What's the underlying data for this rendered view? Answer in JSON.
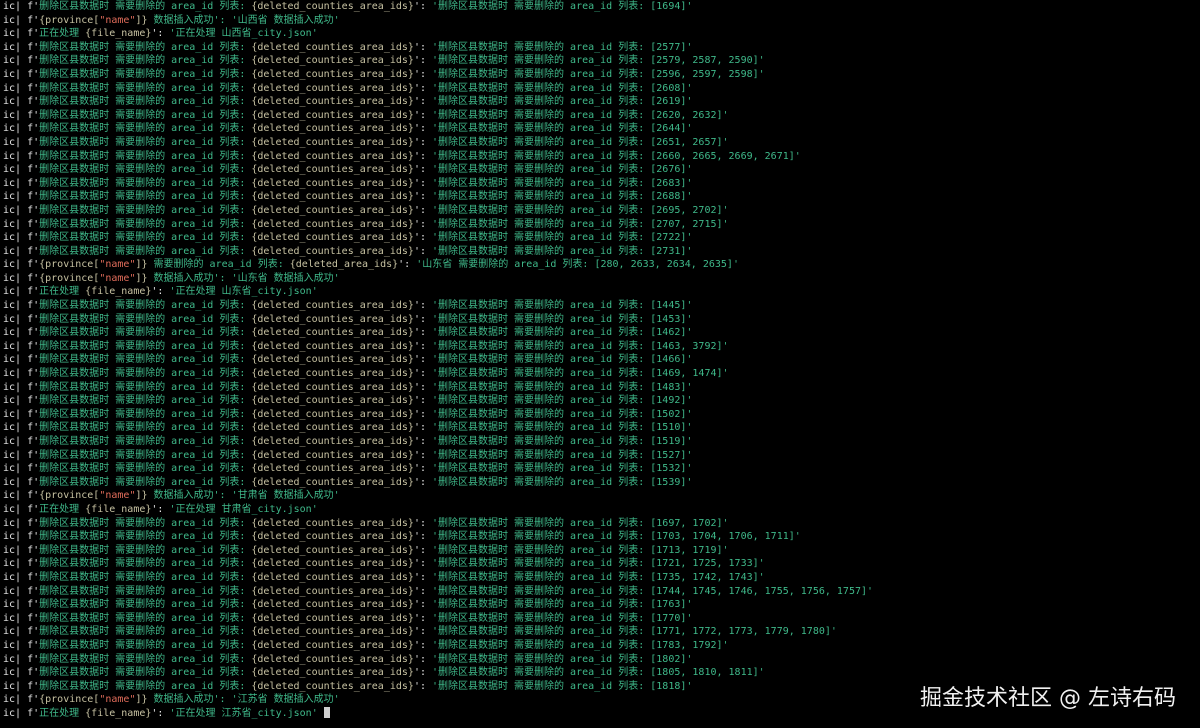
{
  "colors": {
    "background": "#000000",
    "text": "#e6e6e6",
    "string": "#3fb98a",
    "interp": "#c7c2a2",
    "key": "#e06c5a",
    "watermark": "#f0f0f0"
  },
  "lines": [
    [
      [
        "ic| f'",
        "t"
      ],
      [
        "删除区县数据时 需要删除的 area_id 列表: ",
        "s"
      ],
      [
        "{deleted_counties_area_ids}",
        "i"
      ],
      [
        "': ",
        "t"
      ],
      [
        "'删除区县数据时 需要删除的 area_id 列表: [1694]'",
        "s"
      ]
    ],
    [
      [
        "ic| f'",
        "t"
      ],
      [
        "{province[",
        "i"
      ],
      [
        "\"name\"",
        "k"
      ],
      [
        "]}",
        "i"
      ],
      [
        " 数据插入成功': ",
        "s"
      ],
      [
        "'山西省 数据插入成功'",
        "s"
      ]
    ],
    [
      [
        "ic| f'",
        "t"
      ],
      [
        "正在处理 ",
        "s"
      ],
      [
        "{file_name}",
        "i"
      ],
      [
        "': ",
        "t"
      ],
      [
        "'正在处理 山西省_city.json'",
        "s"
      ]
    ],
    [
      [
        "ic| f'",
        "t"
      ],
      [
        "删除区县数据时 需要删除的 area_id 列表: ",
        "s"
      ],
      [
        "{deleted_counties_area_ids}",
        "i"
      ],
      [
        "': ",
        "t"
      ],
      [
        "'删除区县数据时 需要删除的 area_id 列表: [2577]'",
        "s"
      ]
    ],
    [
      [
        "ic| f'",
        "t"
      ],
      [
        "删除区县数据时 需要删除的 area_id 列表: ",
        "s"
      ],
      [
        "{deleted_counties_area_ids}",
        "i"
      ],
      [
        "': ",
        "t"
      ],
      [
        "'删除区县数据时 需要删除的 area_id 列表: [2579, 2587, 2590]'",
        "s"
      ]
    ],
    [
      [
        "ic| f'",
        "t"
      ],
      [
        "删除区县数据时 需要删除的 area_id 列表: ",
        "s"
      ],
      [
        "{deleted_counties_area_ids}",
        "i"
      ],
      [
        "': ",
        "t"
      ],
      [
        "'删除区县数据时 需要删除的 area_id 列表: [2596, 2597, 2598]'",
        "s"
      ]
    ],
    [
      [
        "ic| f'",
        "t"
      ],
      [
        "删除区县数据时 需要删除的 area_id 列表: ",
        "s"
      ],
      [
        "{deleted_counties_area_ids}",
        "i"
      ],
      [
        "': ",
        "t"
      ],
      [
        "'删除区县数据时 需要删除的 area_id 列表: [2608]'",
        "s"
      ]
    ],
    [
      [
        "ic| f'",
        "t"
      ],
      [
        "删除区县数据时 需要删除的 area_id 列表: ",
        "s"
      ],
      [
        "{deleted_counties_area_ids}",
        "i"
      ],
      [
        "': ",
        "t"
      ],
      [
        "'删除区县数据时 需要删除的 area_id 列表: [2619]'",
        "s"
      ]
    ],
    [
      [
        "ic| f'",
        "t"
      ],
      [
        "删除区县数据时 需要删除的 area_id 列表: ",
        "s"
      ],
      [
        "{deleted_counties_area_ids}",
        "i"
      ],
      [
        "': ",
        "t"
      ],
      [
        "'删除区县数据时 需要删除的 area_id 列表: [2620, 2632]'",
        "s"
      ]
    ],
    [
      [
        "ic| f'",
        "t"
      ],
      [
        "删除区县数据时 需要删除的 area_id 列表: ",
        "s"
      ],
      [
        "{deleted_counties_area_ids}",
        "i"
      ],
      [
        "': ",
        "t"
      ],
      [
        "'删除区县数据时 需要删除的 area_id 列表: [2644]'",
        "s"
      ]
    ],
    [
      [
        "ic| f'",
        "t"
      ],
      [
        "删除区县数据时 需要删除的 area_id 列表: ",
        "s"
      ],
      [
        "{deleted_counties_area_ids}",
        "i"
      ],
      [
        "': ",
        "t"
      ],
      [
        "'删除区县数据时 需要删除的 area_id 列表: [2651, 2657]'",
        "s"
      ]
    ],
    [
      [
        "ic| f'",
        "t"
      ],
      [
        "删除区县数据时 需要删除的 area_id 列表: ",
        "s"
      ],
      [
        "{deleted_counties_area_ids}",
        "i"
      ],
      [
        "': ",
        "t"
      ],
      [
        "'删除区县数据时 需要删除的 area_id 列表: [2660, 2665, 2669, 2671]'",
        "s"
      ]
    ],
    [
      [
        "ic| f'",
        "t"
      ],
      [
        "删除区县数据时 需要删除的 area_id 列表: ",
        "s"
      ],
      [
        "{deleted_counties_area_ids}",
        "i"
      ],
      [
        "': ",
        "t"
      ],
      [
        "'删除区县数据时 需要删除的 area_id 列表: [2676]'",
        "s"
      ]
    ],
    [
      [
        "ic| f'",
        "t"
      ],
      [
        "删除区县数据时 需要删除的 area_id 列表: ",
        "s"
      ],
      [
        "{deleted_counties_area_ids}",
        "i"
      ],
      [
        "': ",
        "t"
      ],
      [
        "'删除区县数据时 需要删除的 area_id 列表: [2683]'",
        "s"
      ]
    ],
    [
      [
        "ic| f'",
        "t"
      ],
      [
        "删除区县数据时 需要删除的 area_id 列表: ",
        "s"
      ],
      [
        "{deleted_counties_area_ids}",
        "i"
      ],
      [
        "': ",
        "t"
      ],
      [
        "'删除区县数据时 需要删除的 area_id 列表: [2688]'",
        "s"
      ]
    ],
    [
      [
        "ic| f'",
        "t"
      ],
      [
        "删除区县数据时 需要删除的 area_id 列表: ",
        "s"
      ],
      [
        "{deleted_counties_area_ids}",
        "i"
      ],
      [
        "': ",
        "t"
      ],
      [
        "'删除区县数据时 需要删除的 area_id 列表: [2695, 2702]'",
        "s"
      ]
    ],
    [
      [
        "ic| f'",
        "t"
      ],
      [
        "删除区县数据时 需要删除的 area_id 列表: ",
        "s"
      ],
      [
        "{deleted_counties_area_ids}",
        "i"
      ],
      [
        "': ",
        "t"
      ],
      [
        "'删除区县数据时 需要删除的 area_id 列表: [2707, 2715]'",
        "s"
      ]
    ],
    [
      [
        "ic| f'",
        "t"
      ],
      [
        "删除区县数据时 需要删除的 area_id 列表: ",
        "s"
      ],
      [
        "{deleted_counties_area_ids}",
        "i"
      ],
      [
        "': ",
        "t"
      ],
      [
        "'删除区县数据时 需要删除的 area_id 列表: [2722]'",
        "s"
      ]
    ],
    [
      [
        "ic| f'",
        "t"
      ],
      [
        "删除区县数据时 需要删除的 area_id 列表: ",
        "s"
      ],
      [
        "{deleted_counties_area_ids}",
        "i"
      ],
      [
        "': ",
        "t"
      ],
      [
        "'删除区县数据时 需要删除的 area_id 列表: [2731]'",
        "s"
      ]
    ],
    [
      [
        "ic| f'",
        "t"
      ],
      [
        "{province[",
        "i"
      ],
      [
        "\"name\"",
        "k"
      ],
      [
        "]}",
        "i"
      ],
      [
        " 需要删除的 area_id 列表: ",
        "s"
      ],
      [
        "{deleted_area_ids}",
        "i"
      ],
      [
        "': ",
        "t"
      ],
      [
        "'山东省 需要删除的 area_id 列表: [280, 2633, 2634, 2635]'",
        "s"
      ]
    ],
    [
      [
        "ic| f'",
        "t"
      ],
      [
        "{province[",
        "i"
      ],
      [
        "\"name\"",
        "k"
      ],
      [
        "]}",
        "i"
      ],
      [
        " 数据插入成功': ",
        "s"
      ],
      [
        "'山东省 数据插入成功'",
        "s"
      ]
    ],
    [
      [
        "ic| f'",
        "t"
      ],
      [
        "正在处理 ",
        "s"
      ],
      [
        "{file_name}",
        "i"
      ],
      [
        "': ",
        "t"
      ],
      [
        "'正在处理 山东省_city.json'",
        "s"
      ]
    ],
    [
      [
        "ic| f'",
        "t"
      ],
      [
        "删除区县数据时 需要删除的 area_id 列表: ",
        "s"
      ],
      [
        "{deleted_counties_area_ids}",
        "i"
      ],
      [
        "': ",
        "t"
      ],
      [
        "'删除区县数据时 需要删除的 area_id 列表: [1445]'",
        "s"
      ]
    ],
    [
      [
        "ic| f'",
        "t"
      ],
      [
        "删除区县数据时 需要删除的 area_id 列表: ",
        "s"
      ],
      [
        "{deleted_counties_area_ids}",
        "i"
      ],
      [
        "': ",
        "t"
      ],
      [
        "'删除区县数据时 需要删除的 area_id 列表: [1453]'",
        "s"
      ]
    ],
    [
      [
        "ic| f'",
        "t"
      ],
      [
        "删除区县数据时 需要删除的 area_id 列表: ",
        "s"
      ],
      [
        "{deleted_counties_area_ids}",
        "i"
      ],
      [
        "': ",
        "t"
      ],
      [
        "'删除区县数据时 需要删除的 area_id 列表: [1462]'",
        "s"
      ]
    ],
    [
      [
        "ic| f'",
        "t"
      ],
      [
        "删除区县数据时 需要删除的 area_id 列表: ",
        "s"
      ],
      [
        "{deleted_counties_area_ids}",
        "i"
      ],
      [
        "': ",
        "t"
      ],
      [
        "'删除区县数据时 需要删除的 area_id 列表: [1463, 3792]'",
        "s"
      ]
    ],
    [
      [
        "ic| f'",
        "t"
      ],
      [
        "删除区县数据时 需要删除的 area_id 列表: ",
        "s"
      ],
      [
        "{deleted_counties_area_ids}",
        "i"
      ],
      [
        "': ",
        "t"
      ],
      [
        "'删除区县数据时 需要删除的 area_id 列表: [1466]'",
        "s"
      ]
    ],
    [
      [
        "ic| f'",
        "t"
      ],
      [
        "删除区县数据时 需要删除的 area_id 列表: ",
        "s"
      ],
      [
        "{deleted_counties_area_ids}",
        "i"
      ],
      [
        "': ",
        "t"
      ],
      [
        "'删除区县数据时 需要删除的 area_id 列表: [1469, 1474]'",
        "s"
      ]
    ],
    [
      [
        "ic| f'",
        "t"
      ],
      [
        "删除区县数据时 需要删除的 area_id 列表: ",
        "s"
      ],
      [
        "{deleted_counties_area_ids}",
        "i"
      ],
      [
        "': ",
        "t"
      ],
      [
        "'删除区县数据时 需要删除的 area_id 列表: [1483]'",
        "s"
      ]
    ],
    [
      [
        "ic| f'",
        "t"
      ],
      [
        "删除区县数据时 需要删除的 area_id 列表: ",
        "s"
      ],
      [
        "{deleted_counties_area_ids}",
        "i"
      ],
      [
        "': ",
        "t"
      ],
      [
        "'删除区县数据时 需要删除的 area_id 列表: [1492]'",
        "s"
      ]
    ],
    [
      [
        "ic| f'",
        "t"
      ],
      [
        "删除区县数据时 需要删除的 area_id 列表: ",
        "s"
      ],
      [
        "{deleted_counties_area_ids}",
        "i"
      ],
      [
        "': ",
        "t"
      ],
      [
        "'删除区县数据时 需要删除的 area_id 列表: [1502]'",
        "s"
      ]
    ],
    [
      [
        "ic| f'",
        "t"
      ],
      [
        "删除区县数据时 需要删除的 area_id 列表: ",
        "s"
      ],
      [
        "{deleted_counties_area_ids}",
        "i"
      ],
      [
        "': ",
        "t"
      ],
      [
        "'删除区县数据时 需要删除的 area_id 列表: [1510]'",
        "s"
      ]
    ],
    [
      [
        "ic| f'",
        "t"
      ],
      [
        "删除区县数据时 需要删除的 area_id 列表: ",
        "s"
      ],
      [
        "{deleted_counties_area_ids}",
        "i"
      ],
      [
        "': ",
        "t"
      ],
      [
        "'删除区县数据时 需要删除的 area_id 列表: [1519]'",
        "s"
      ]
    ],
    [
      [
        "ic| f'",
        "t"
      ],
      [
        "删除区县数据时 需要删除的 area_id 列表: ",
        "s"
      ],
      [
        "{deleted_counties_area_ids}",
        "i"
      ],
      [
        "': ",
        "t"
      ],
      [
        "'删除区县数据时 需要删除的 area_id 列表: [1527]'",
        "s"
      ]
    ],
    [
      [
        "ic| f'",
        "t"
      ],
      [
        "删除区县数据时 需要删除的 area_id 列表: ",
        "s"
      ],
      [
        "{deleted_counties_area_ids}",
        "i"
      ],
      [
        "': ",
        "t"
      ],
      [
        "'删除区县数据时 需要删除的 area_id 列表: [1532]'",
        "s"
      ]
    ],
    [
      [
        "ic| f'",
        "t"
      ],
      [
        "删除区县数据时 需要删除的 area_id 列表: ",
        "s"
      ],
      [
        "{deleted_counties_area_ids}",
        "i"
      ],
      [
        "': ",
        "t"
      ],
      [
        "'删除区县数据时 需要删除的 area_id 列表: [1539]'",
        "s"
      ]
    ],
    [
      [
        "ic| f'",
        "t"
      ],
      [
        "{province[",
        "i"
      ],
      [
        "\"name\"",
        "k"
      ],
      [
        "]}",
        "i"
      ],
      [
        " 数据插入成功': ",
        "s"
      ],
      [
        "'甘肃省 数据插入成功'",
        "s"
      ]
    ],
    [
      [
        "ic| f'",
        "t"
      ],
      [
        "正在处理 ",
        "s"
      ],
      [
        "{file_name}",
        "i"
      ],
      [
        "': ",
        "t"
      ],
      [
        "'正在处理 甘肃省_city.json'",
        "s"
      ]
    ],
    [
      [
        "ic| f'",
        "t"
      ],
      [
        "删除区县数据时 需要删除的 area_id 列表: ",
        "s"
      ],
      [
        "{deleted_counties_area_ids}",
        "i"
      ],
      [
        "': ",
        "t"
      ],
      [
        "'删除区县数据时 需要删除的 area_id 列表: [1697, 1702]'",
        "s"
      ]
    ],
    [
      [
        "ic| f'",
        "t"
      ],
      [
        "删除区县数据时 需要删除的 area_id 列表: ",
        "s"
      ],
      [
        "{deleted_counties_area_ids}",
        "i"
      ],
      [
        "': ",
        "t"
      ],
      [
        "'删除区县数据时 需要删除的 area_id 列表: [1703, 1704, 1706, 1711]'",
        "s"
      ]
    ],
    [
      [
        "ic| f'",
        "t"
      ],
      [
        "删除区县数据时 需要删除的 area_id 列表: ",
        "s"
      ],
      [
        "{deleted_counties_area_ids}",
        "i"
      ],
      [
        "': ",
        "t"
      ],
      [
        "'删除区县数据时 需要删除的 area_id 列表: [1713, 1719]'",
        "s"
      ]
    ],
    [
      [
        "ic| f'",
        "t"
      ],
      [
        "删除区县数据时 需要删除的 area_id 列表: ",
        "s"
      ],
      [
        "{deleted_counties_area_ids}",
        "i"
      ],
      [
        "': ",
        "t"
      ],
      [
        "'删除区县数据时 需要删除的 area_id 列表: [1721, 1725, 1733]'",
        "s"
      ]
    ],
    [
      [
        "ic| f'",
        "t"
      ],
      [
        "删除区县数据时 需要删除的 area_id 列表: ",
        "s"
      ],
      [
        "{deleted_counties_area_ids}",
        "i"
      ],
      [
        "': ",
        "t"
      ],
      [
        "'删除区县数据时 需要删除的 area_id 列表: [1735, 1742, 1743]'",
        "s"
      ]
    ],
    [
      [
        "ic| f'",
        "t"
      ],
      [
        "删除区县数据时 需要删除的 area_id 列表: ",
        "s"
      ],
      [
        "{deleted_counties_area_ids}",
        "i"
      ],
      [
        "': ",
        "t"
      ],
      [
        "'删除区县数据时 需要删除的 area_id 列表: [1744, 1745, 1746, 1755, 1756, 1757]'",
        "s"
      ]
    ],
    [
      [
        "ic| f'",
        "t"
      ],
      [
        "删除区县数据时 需要删除的 area_id 列表: ",
        "s"
      ],
      [
        "{deleted_counties_area_ids}",
        "i"
      ],
      [
        "': ",
        "t"
      ],
      [
        "'删除区县数据时 需要删除的 area_id 列表: [1763]'",
        "s"
      ]
    ],
    [
      [
        "ic| f'",
        "t"
      ],
      [
        "删除区县数据时 需要删除的 area_id 列表: ",
        "s"
      ],
      [
        "{deleted_counties_area_ids}",
        "i"
      ],
      [
        "': ",
        "t"
      ],
      [
        "'删除区县数据时 需要删除的 area_id 列表: [1770]'",
        "s"
      ]
    ],
    [
      [
        "ic| f'",
        "t"
      ],
      [
        "删除区县数据时 需要删除的 area_id 列表: ",
        "s"
      ],
      [
        "{deleted_counties_area_ids}",
        "i"
      ],
      [
        "': ",
        "t"
      ],
      [
        "'删除区县数据时 需要删除的 area_id 列表: [1771, 1772, 1773, 1779, 1780]'",
        "s"
      ]
    ],
    [
      [
        "ic| f'",
        "t"
      ],
      [
        "删除区县数据时 需要删除的 area_id 列表: ",
        "s"
      ],
      [
        "{deleted_counties_area_ids}",
        "i"
      ],
      [
        "': ",
        "t"
      ],
      [
        "'删除区县数据时 需要删除的 area_id 列表: [1783, 1792]'",
        "s"
      ]
    ],
    [
      [
        "ic| f'",
        "t"
      ],
      [
        "删除区县数据时 需要删除的 area_id 列表: ",
        "s"
      ],
      [
        "{deleted_counties_area_ids}",
        "i"
      ],
      [
        "': ",
        "t"
      ],
      [
        "'删除区县数据时 需要删除的 area_id 列表: [1802]'",
        "s"
      ]
    ],
    [
      [
        "ic| f'",
        "t"
      ],
      [
        "删除区县数据时 需要删除的 area_id 列表: ",
        "s"
      ],
      [
        "{deleted_counties_area_ids}",
        "i"
      ],
      [
        "': ",
        "t"
      ],
      [
        "'删除区县数据时 需要删除的 area_id 列表: [1805, 1810, 1811]'",
        "s"
      ]
    ],
    [
      [
        "ic| f'",
        "t"
      ],
      [
        "删除区县数据时 需要删除的 area_id 列表: ",
        "s"
      ],
      [
        "{deleted_counties_area_ids}",
        "i"
      ],
      [
        "': ",
        "t"
      ],
      [
        "'删除区县数据时 需要删除的 area_id 列表: [1818]'",
        "s"
      ]
    ],
    [
      [
        "ic| f'",
        "t"
      ],
      [
        "{province[",
        "i"
      ],
      [
        "\"name\"",
        "k"
      ],
      [
        "]}",
        "i"
      ],
      [
        " 数据插入成功': ",
        "s"
      ],
      [
        "'江苏省 数据插入成功'",
        "s"
      ]
    ],
    [
      [
        "ic| f'",
        "t"
      ],
      [
        "正在处理 ",
        "s"
      ],
      [
        "{file_name}",
        "i"
      ],
      [
        "': ",
        "t"
      ],
      [
        "'正在处理 江苏省_city.json'",
        "s"
      ]
    ]
  ],
  "watermark": {
    "text": "掘金技术社区 @ 左诗右码"
  }
}
